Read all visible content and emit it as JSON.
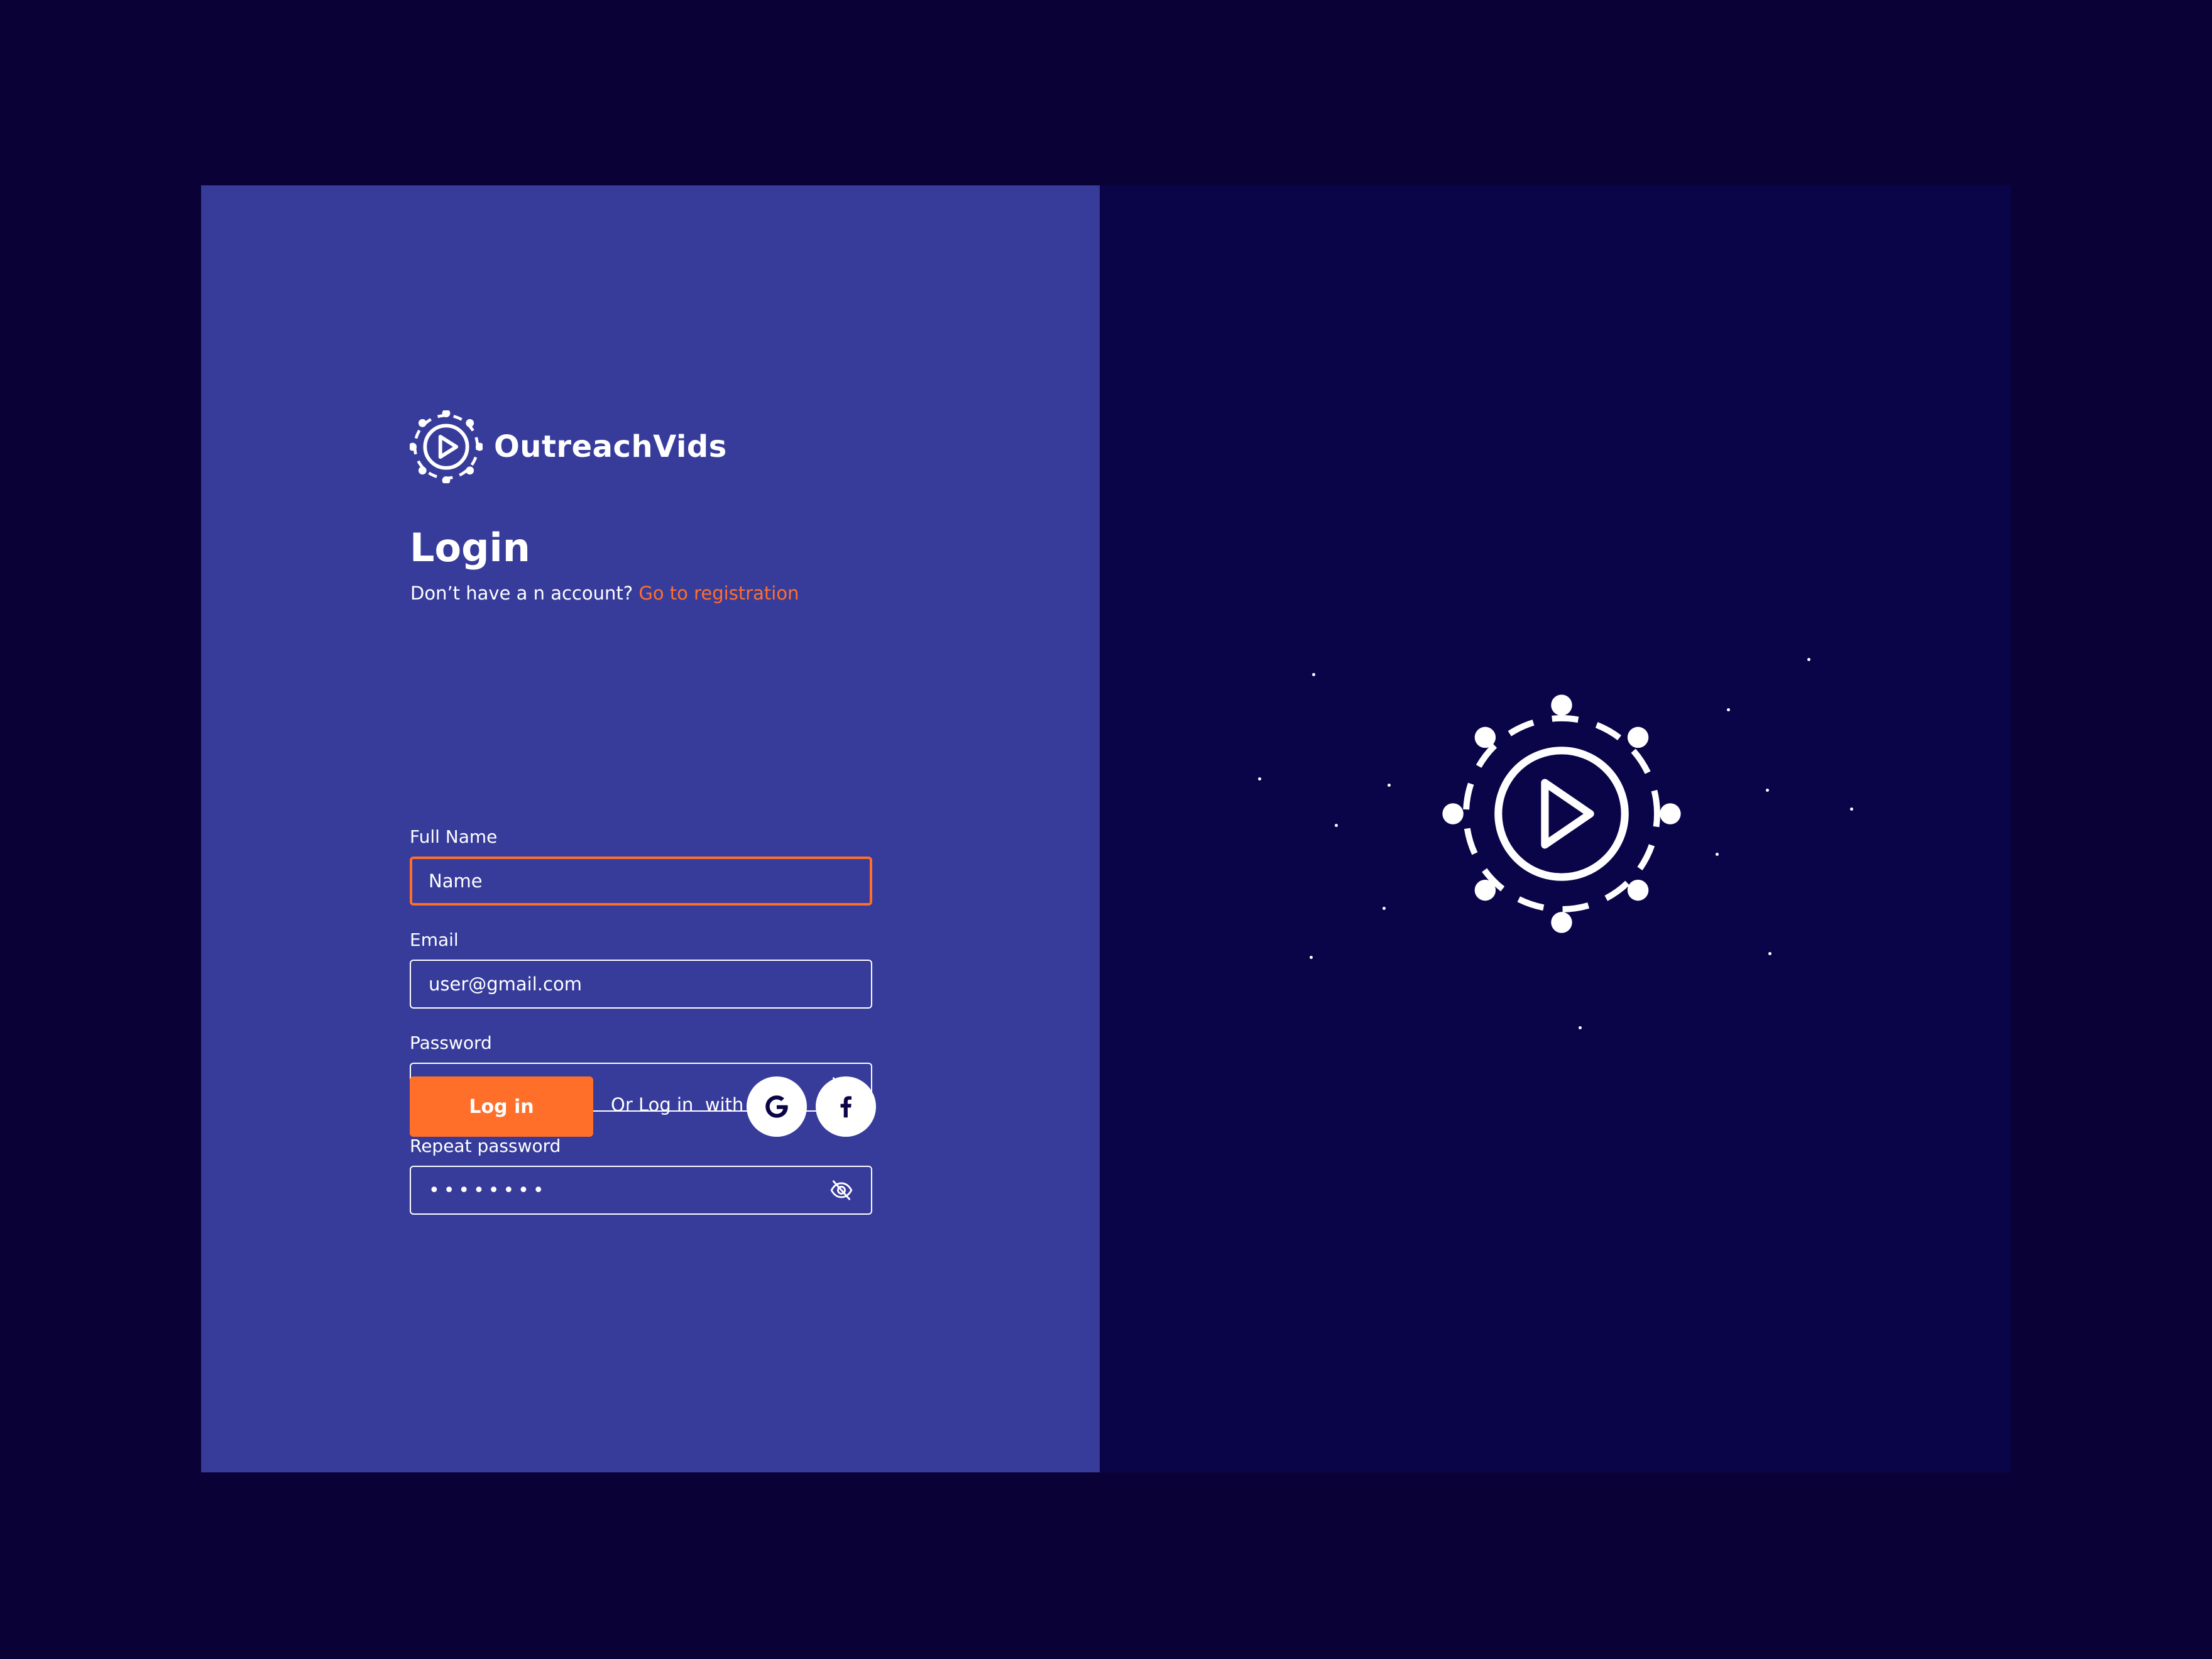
{
  "brand": {
    "name": "OutreachVids",
    "logo_icon": "play-circle-dots-icon"
  },
  "login": {
    "title": "Login",
    "subtitle_prefix": "Don’t have a n account?",
    "registration_link": "Go to registration"
  },
  "form": {
    "full_name": {
      "label": "Full Name",
      "value": "Name"
    },
    "email": {
      "label": "Email",
      "value": "user@gmail.com"
    },
    "password": {
      "label": "Password",
      "value": "••••••••",
      "toggle_icon": "eye-off-icon"
    },
    "repeat_password": {
      "label": "Repeat password",
      "value": "••••••••",
      "toggle_icon": "eye-off-icon"
    }
  },
  "actions": {
    "login_label": "Log in",
    "or_text": "Or Log in  with",
    "social": [
      "google-icon",
      "facebook-icon"
    ]
  },
  "colors": {
    "page_background": "#0a0236",
    "left_panel": "#373c9b",
    "right_panel": "#0a0548",
    "accent": "#ff6f2a",
    "text": "#ffffff"
  }
}
